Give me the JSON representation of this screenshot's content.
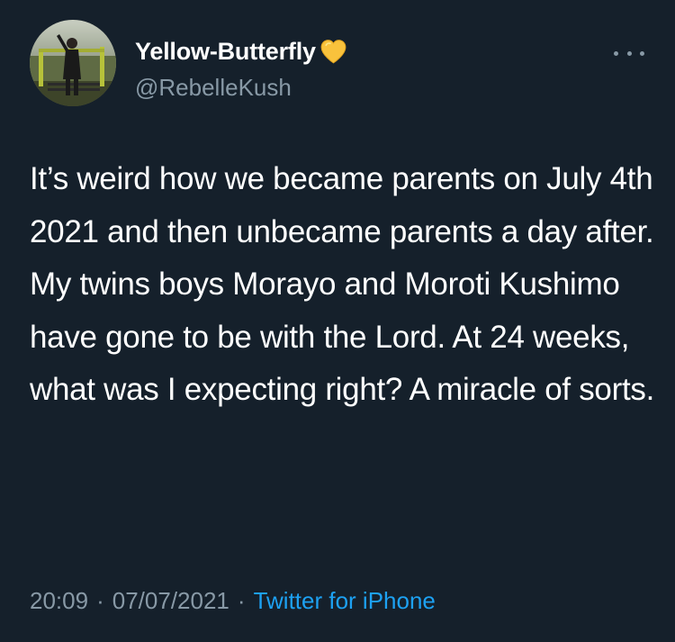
{
  "tweet": {
    "display_name": "Yellow-Butterfly",
    "name_emoji_icon": "yellow-heart-icon",
    "handle": "@RebelleKush",
    "text": "It’s weird how we became parents on July 4th 2021 and then unbecame parents a day after. My twins boys Morayo and Moroti Kushimo have gone to be with the Lord. At 24 weeks, what was I expecting right? A miracle of sorts.",
    "time": "20:09",
    "date": "07/07/2021",
    "source": "Twitter for iPhone",
    "separator": "·"
  },
  "colors": {
    "background": "#15202b",
    "primary_text": "#ffffff",
    "secondary_text": "#8899a6",
    "link": "#1da1f2",
    "heart": "#f9c23c"
  }
}
